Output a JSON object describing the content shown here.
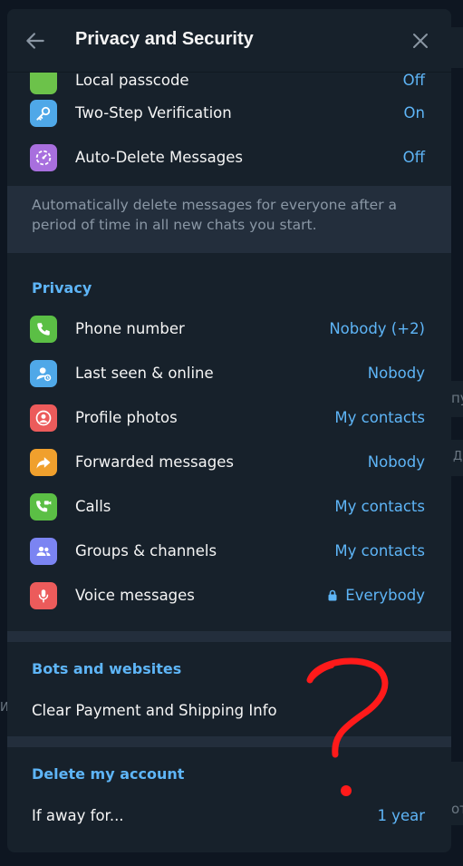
{
  "header": {
    "title": "Privacy and Security"
  },
  "top_rows": [
    {
      "label": "Local passcode",
      "value": "Off",
      "color": "#6cc24a"
    },
    {
      "label": "Two-Step Verification",
      "value": "On",
      "color": "#4fa8e8"
    },
    {
      "label": "Auto-Delete Messages",
      "value": "Off",
      "color": "#a86fde"
    }
  ],
  "auto_delete_note": "Automatically delete messages for everyone after a period of time in all new chats you start.",
  "privacy": {
    "title": "Privacy",
    "rows": [
      {
        "label": "Phone number",
        "value": "Nobody (+2)",
        "color": "#5bbf45",
        "icon": "phone-icon"
      },
      {
        "label": "Last seen & online",
        "value": "Nobody",
        "color": "#4fa8e8",
        "icon": "person-icon"
      },
      {
        "label": "Profile photos",
        "value": "My contacts",
        "color": "#ec5b5b",
        "icon": "profile-icon"
      },
      {
        "label": "Forwarded messages",
        "value": "Nobody",
        "color": "#f0a02d",
        "icon": "forward-icon"
      },
      {
        "label": "Calls",
        "value": "My contacts",
        "color": "#5bbf45",
        "icon": "video-call-icon"
      },
      {
        "label": "Groups & channels",
        "value": "My contacts",
        "color": "#7b84f2",
        "icon": "group-icon"
      },
      {
        "label": "Voice messages",
        "value": "Everybody",
        "color": "#ec5b5b",
        "icon": "microphone-icon",
        "locked": true
      }
    ]
  },
  "bots": {
    "title": "Bots and websites",
    "clear_label": "Clear Payment and Shipping Info"
  },
  "delete_account": {
    "title": "Delete my account",
    "away_label": "If away for...",
    "away_value": "1 year"
  },
  "background_text": {
    "right_top": "пу",
    "right_mid": "Д",
    "left_mid": "И",
    "right_bottom": "от"
  }
}
